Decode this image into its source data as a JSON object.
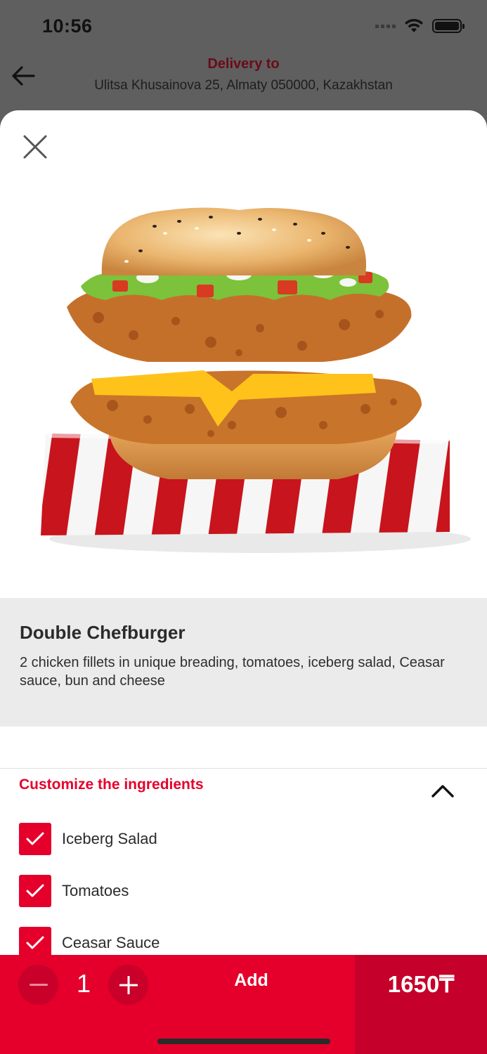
{
  "status_bar": {
    "time": "10:56"
  },
  "header": {
    "delivery_title": "Delivery to",
    "delivery_address": "Ulitsa Khusainova 25, Almaty 050000, Kazakhstan"
  },
  "product": {
    "name": "Double Chefburger",
    "description": "2 chicken fillets in unique breading, tomatoes, iceberg salad, Ceasar sauce, bun and cheese"
  },
  "customize": {
    "title": "Customize the ingredients",
    "ingredients": [
      {
        "label": "Iceberg Salad",
        "checked": true
      },
      {
        "label": "Tomatoes",
        "checked": true
      },
      {
        "label": "Ceasar Sauce",
        "checked": true
      }
    ]
  },
  "order": {
    "quantity": "1",
    "add_label": "Add",
    "price": "1650₸"
  },
  "colors": {
    "accent": "#e4002b",
    "accent_dark": "#c5002a",
    "delivery_title": "#6a0b18"
  }
}
